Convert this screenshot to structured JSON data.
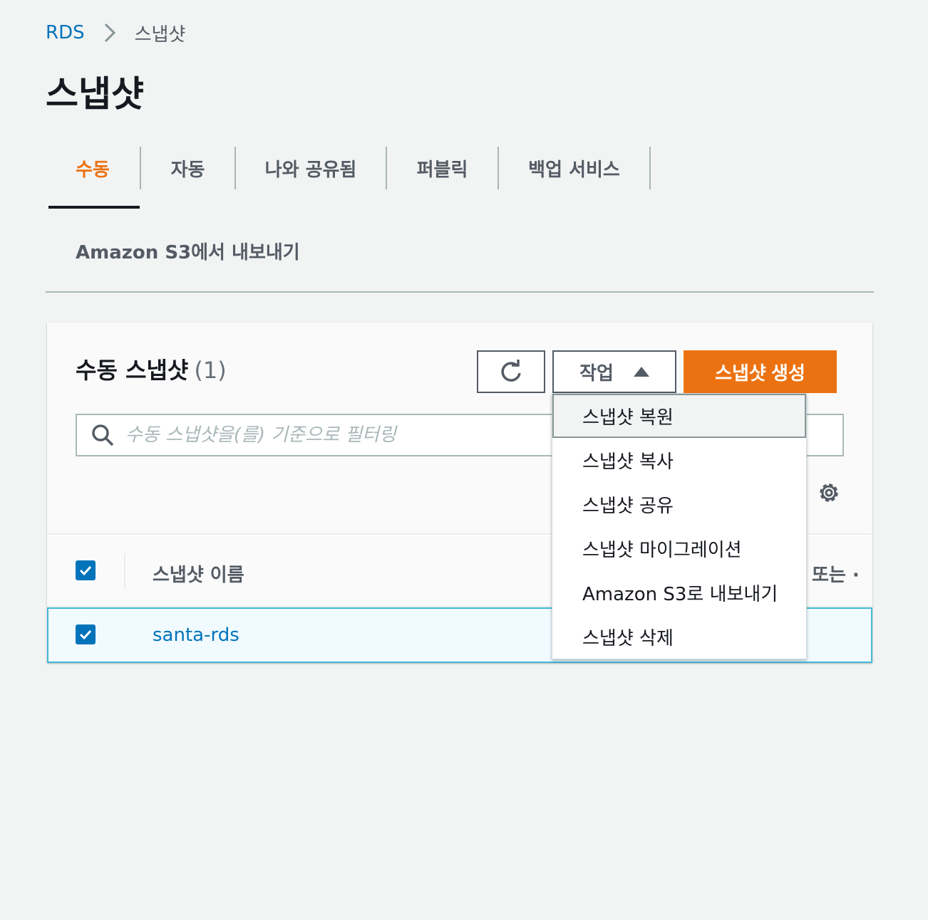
{
  "breadcrumb": {
    "root": "RDS",
    "current": "스냅샷"
  },
  "page": {
    "title": "스냅샷"
  },
  "tabs": [
    {
      "label": "수동",
      "active": true
    },
    {
      "label": "자동",
      "active": false
    },
    {
      "label": "나와 공유됨",
      "active": false
    },
    {
      "label": "퍼블릭",
      "active": false
    },
    {
      "label": "백업 서비스",
      "active": false
    }
  ],
  "tabs_row2": {
    "label": "Amazon S3에서 내보내기"
  },
  "panel": {
    "title": "수동 스냅샷",
    "count": "(1)",
    "actions_label": "작업",
    "create_label": "스냅샷 생성",
    "search_placeholder": "수동 스냅샷을(를) 기준으로 필터링"
  },
  "table": {
    "columns": [
      "스냅샷 이름",
      "스 또는 ·"
    ],
    "rows": [
      {
        "name": "santa-rds",
        "selected": true
      }
    ]
  },
  "dropdown": {
    "items": [
      {
        "label": "스냅샷 복원",
        "highlighted": true
      },
      {
        "label": "스냅샷 복사"
      },
      {
        "label": "스냅샷 공유"
      },
      {
        "label": "스냅샷 마이그레이션"
      },
      {
        "label": "Amazon S3로 내보내기"
      },
      {
        "label": "스냅샷 삭제"
      }
    ]
  },
  "colors": {
    "accent": "#ec7211",
    "link": "#0073bb",
    "selected_row_border": "#44b9d6"
  }
}
